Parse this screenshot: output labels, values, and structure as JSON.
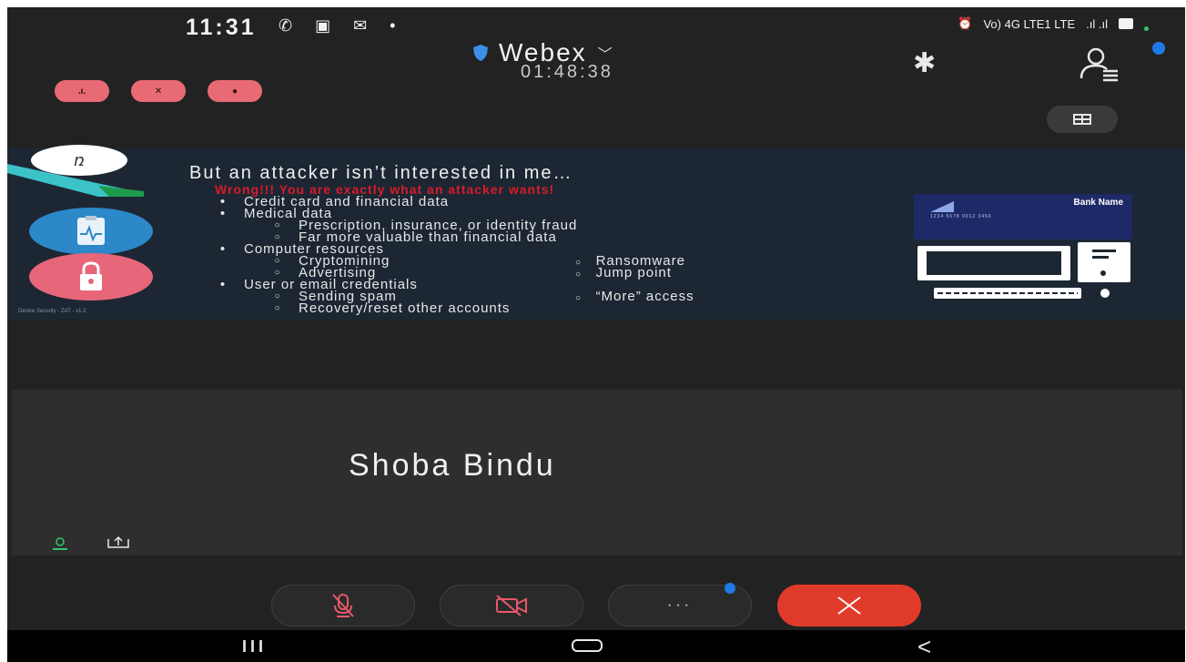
{
  "status_bar": {
    "time": "11:31",
    "left_icons": "✆ ▣ ✉ •",
    "network": "Vo) 4G LTE1 LTE",
    "signal": ".ıl .ıl"
  },
  "header": {
    "app_name": "Webex",
    "meeting_timer": "01:48:38"
  },
  "slide": {
    "title": "But an attacker isn’t interested in me…",
    "subtitle": "Wrong!!! You are exactly what an attacker wants!",
    "items": [
      {
        "level": 1,
        "text": "Credit card and financial data"
      },
      {
        "level": 1,
        "text": "Medical data"
      },
      {
        "level": 2,
        "text": "Prescription, insurance, or identity fraud"
      },
      {
        "level": 2,
        "text": "Far more valuable than financial data"
      },
      {
        "level": 1,
        "text": "Computer resources"
      },
      {
        "level": 2,
        "text": "Cryptomining",
        "col2": "Ransomware"
      },
      {
        "level": 2,
        "text": "Advertising",
        "col2": "Jump point"
      },
      {
        "level": 1,
        "text": "User or email credentials"
      },
      {
        "level": 2,
        "text": "Sending spam",
        "col2": "“More” access"
      },
      {
        "level": 2,
        "text": "Recovery/reset other accounts"
      }
    ],
    "bank_card": {
      "name": "Bank Name",
      "numbers": "1234 5678 9012 3456"
    },
    "footer": "Device Security - ZAT - v1.2"
  },
  "participant": {
    "name": "Shoba Bindu"
  },
  "controls": {
    "more_label": "···"
  },
  "nav": {
    "recent_label": "III",
    "back_label": "<"
  },
  "colors": {
    "end_call": "#e03a2b",
    "accent_blue": "#1f7ae6",
    "muted_red": "#e86a74"
  },
  "icons": [
    "whatsapp-icon",
    "gallery-icon",
    "gmail-icon",
    "shield-icon",
    "chevron-down-icon",
    "bluetooth-icon",
    "participants-icon",
    "layout-icon",
    "mic-muted-icon",
    "video-off-icon",
    "more-icon",
    "close-icon",
    "user-icon",
    "share-icon"
  ]
}
